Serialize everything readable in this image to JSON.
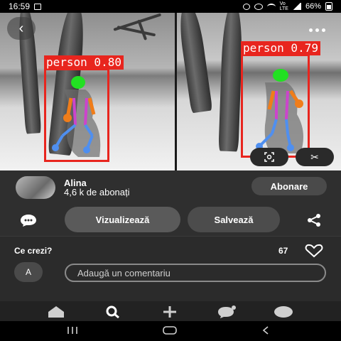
{
  "status_bar": {
    "time": "16:59",
    "battery": "66%",
    "icons": [
      "image-icon",
      "alarm-icon",
      "hotspot-icon",
      "wifi-icon",
      "volte-icon",
      "signal-icon",
      "battery-icon"
    ]
  },
  "photo": {
    "detections": [
      {
        "label": "person 0.80"
      },
      {
        "label": "person 0.79"
      }
    ],
    "colors": {
      "box": "#e8251e",
      "head": "#22e022",
      "arms": "#f07d1a",
      "torso": "#cc44cc",
      "legs": "#4f8ff0"
    }
  },
  "author": {
    "name": "Alina",
    "subscribers": "4,6 k de abonați",
    "subscribe_label": "Abonare"
  },
  "actions": {
    "visualize_label": "Vizualizează",
    "save_label": "Salvează"
  },
  "comments": {
    "title": "Ce crezi?",
    "likes": "67",
    "user_initial": "A",
    "placeholder": "Adaugă un comentariu"
  },
  "bottom_nav": [
    "home-icon",
    "search-icon",
    "create-icon",
    "messages-icon",
    "profile-icon"
  ],
  "system_nav": [
    "recents-button",
    "home-button",
    "back-button"
  ]
}
